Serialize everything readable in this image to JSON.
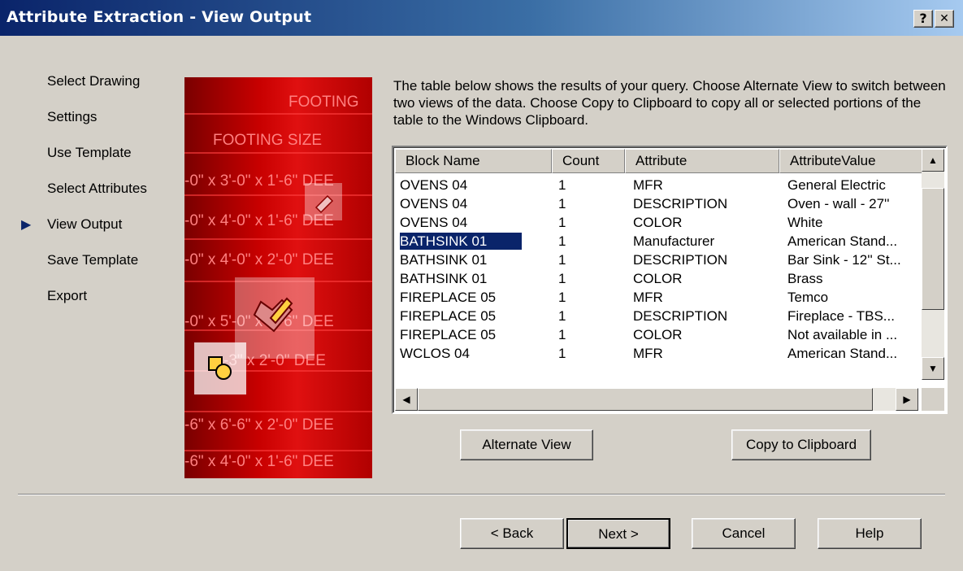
{
  "window": {
    "title": "Attribute Extraction - View Output",
    "help_glyph": "?",
    "close_glyph": "✕"
  },
  "steps": [
    {
      "label": "Select Drawing"
    },
    {
      "label": "Settings"
    },
    {
      "label": "Use Template"
    },
    {
      "label": "Select Attributes"
    },
    {
      "label": "View Output",
      "active": true
    },
    {
      "label": "Save Template"
    },
    {
      "label": "Export"
    }
  ],
  "current_step_icon": "arrow-right-icon",
  "illustration": {
    "rows": [
      "FOOTING",
      "FOOTING SIZE",
      "-0\" x 3'-0\" x 1'-6\" DEE",
      "-0\" x 4'-0\" x 1'-6\" DEE",
      "-0\" x 4'-0\" x 2'-0\" DEE",
      "-0\" x 5'-0\" x 1'-6\" DEE",
      "-3\" x 2'-0\" DEE",
      "-6\" x 6'-6\" x 2'-0\" DEE",
      "-6\" x 4'-0\" x 1'-6\" DEE"
    ]
  },
  "description": "The table below shows the results of your query. Choose Alternate View to switch between two views of the data. Choose Copy to Clipboard to copy all or selected portions of the table to the Windows Clipboard.",
  "table": {
    "columns": [
      "Block Name",
      "Count",
      "Attribute",
      "AttributeValue"
    ],
    "rows": [
      [
        "OVENS 04",
        "1",
        "MFR",
        "General Electric"
      ],
      [
        "OVENS 04",
        "1",
        "DESCRIPTION",
        "Oven - wall - 27''"
      ],
      [
        "OVENS 04",
        "1",
        "COLOR",
        "White"
      ],
      [
        "BATHSINK 01",
        "1",
        "Manufacturer",
        "American Stand..."
      ],
      [
        "BATHSINK 01",
        "1",
        "DESCRIPTION",
        "Bar Sink - 12'' St..."
      ],
      [
        "BATHSINK 01",
        "1",
        "COLOR",
        "Brass"
      ],
      [
        "FIREPLACE 05",
        "1",
        "MFR",
        "Temco"
      ],
      [
        "FIREPLACE 05",
        "1",
        "DESCRIPTION",
        "Fireplace - TBS..."
      ],
      [
        "FIREPLACE 05",
        "1",
        "COLOR",
        "Not available in ..."
      ],
      [
        "WCLOS 04",
        "1",
        "MFR",
        "American Stand..."
      ]
    ],
    "selected_row": 3
  },
  "buttons": {
    "alternate_view": "Alternate View",
    "copy_clipboard": "Copy to Clipboard",
    "back": "< Back",
    "next": "Next >",
    "cancel": "Cancel",
    "help": "Help"
  },
  "colors": {
    "title_bar": "#0a246a",
    "selection": "#0a246a",
    "dialog_bg": "#d4d0c8"
  }
}
